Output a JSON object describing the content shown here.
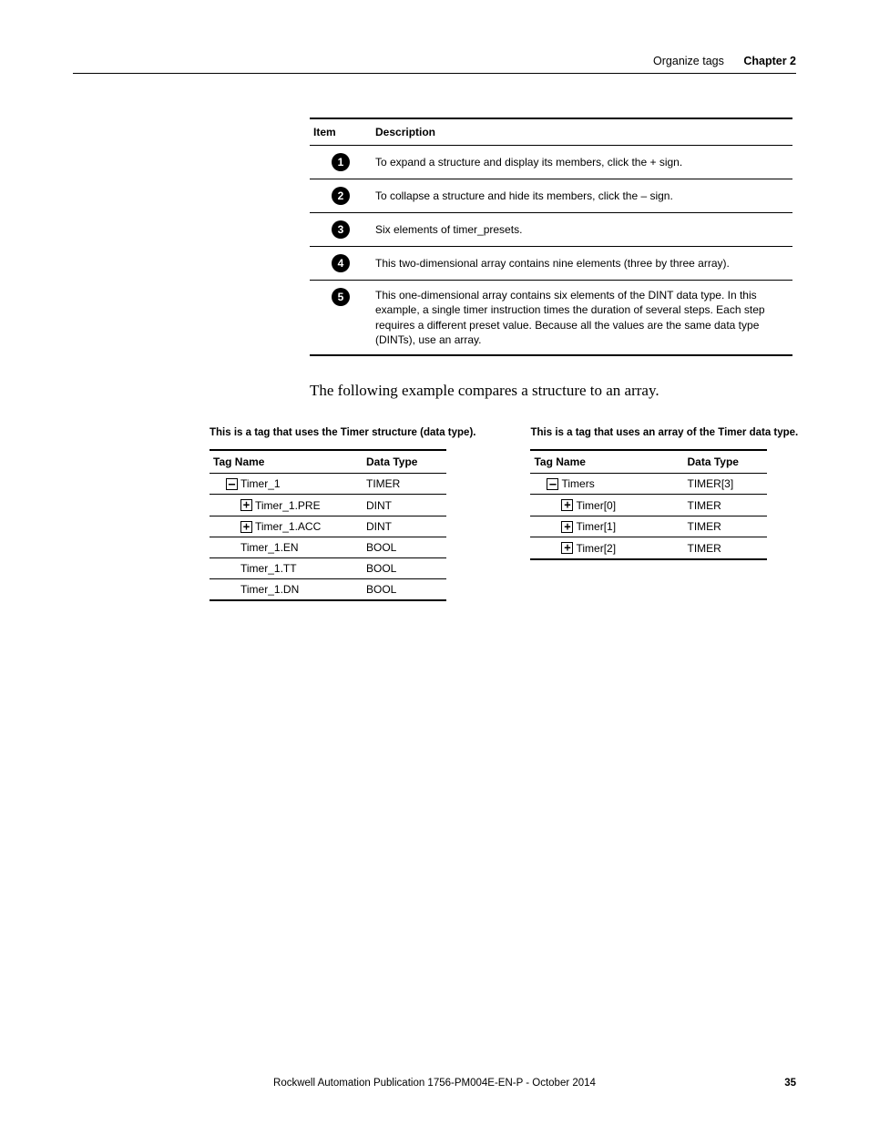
{
  "header": {
    "section": "Organize tags",
    "chapter": "Chapter 2"
  },
  "item_table": {
    "headers": {
      "item": "Item",
      "desc": "Description"
    },
    "rows": [
      {
        "num": "1",
        "desc": "To expand a structure and display its members, click the + sign."
      },
      {
        "num": "2",
        "desc": "To collapse a structure and hide its members, click the – sign."
      },
      {
        "num": "3",
        "desc": "Six elements of timer_presets."
      },
      {
        "num": "4",
        "desc": "This two-dimensional array contains nine elements (three by three array)."
      },
      {
        "num": "5",
        "desc": "This one-dimensional array contains six elements of the DINT data type. In this example, a single timer instruction times the duration of several steps. Each step requires a different preset value. Because all the values are the same data type (DINTs), use an array."
      }
    ]
  },
  "body_text": "The following example compares a structure to an array.",
  "compare": {
    "left": {
      "caption": "This is a tag that uses the Timer structure (data type).",
      "headers": {
        "tag": "Tag Name",
        "type": "Data Type"
      },
      "rows": [
        {
          "indent": 1,
          "box": "–",
          "name": "Timer_1",
          "type": "TIMER"
        },
        {
          "indent": 2,
          "box": "+",
          "name": "Timer_1.PRE",
          "type": "DINT"
        },
        {
          "indent": 2,
          "box": "+",
          "name": "Timer_1.ACC",
          "type": "DINT"
        },
        {
          "indent": 2,
          "box": "",
          "name": "Timer_1.EN",
          "type": "BOOL"
        },
        {
          "indent": 2,
          "box": "",
          "name": "Timer_1.TT",
          "type": "BOOL"
        },
        {
          "indent": 2,
          "box": "",
          "name": "Timer_1.DN",
          "type": "BOOL"
        }
      ]
    },
    "right": {
      "caption": "This is a tag that uses an array of the Timer data type.",
      "headers": {
        "tag": "Tag Name",
        "type": "Data Type"
      },
      "rows": [
        {
          "indent": 1,
          "box": "–",
          "name": "Timers",
          "type": "TIMER[3]"
        },
        {
          "indent": 2,
          "box": "+",
          "name": "Timer[0]",
          "type": "TIMER"
        },
        {
          "indent": 2,
          "box": "+",
          "name": "Timer[1]",
          "type": "TIMER"
        },
        {
          "indent": 2,
          "box": "+",
          "name": "Timer[2]",
          "type": "TIMER"
        }
      ]
    }
  },
  "footer": {
    "publication": "Rockwell Automation Publication 1756-PM004E-EN-P - October 2014",
    "page": "35"
  }
}
